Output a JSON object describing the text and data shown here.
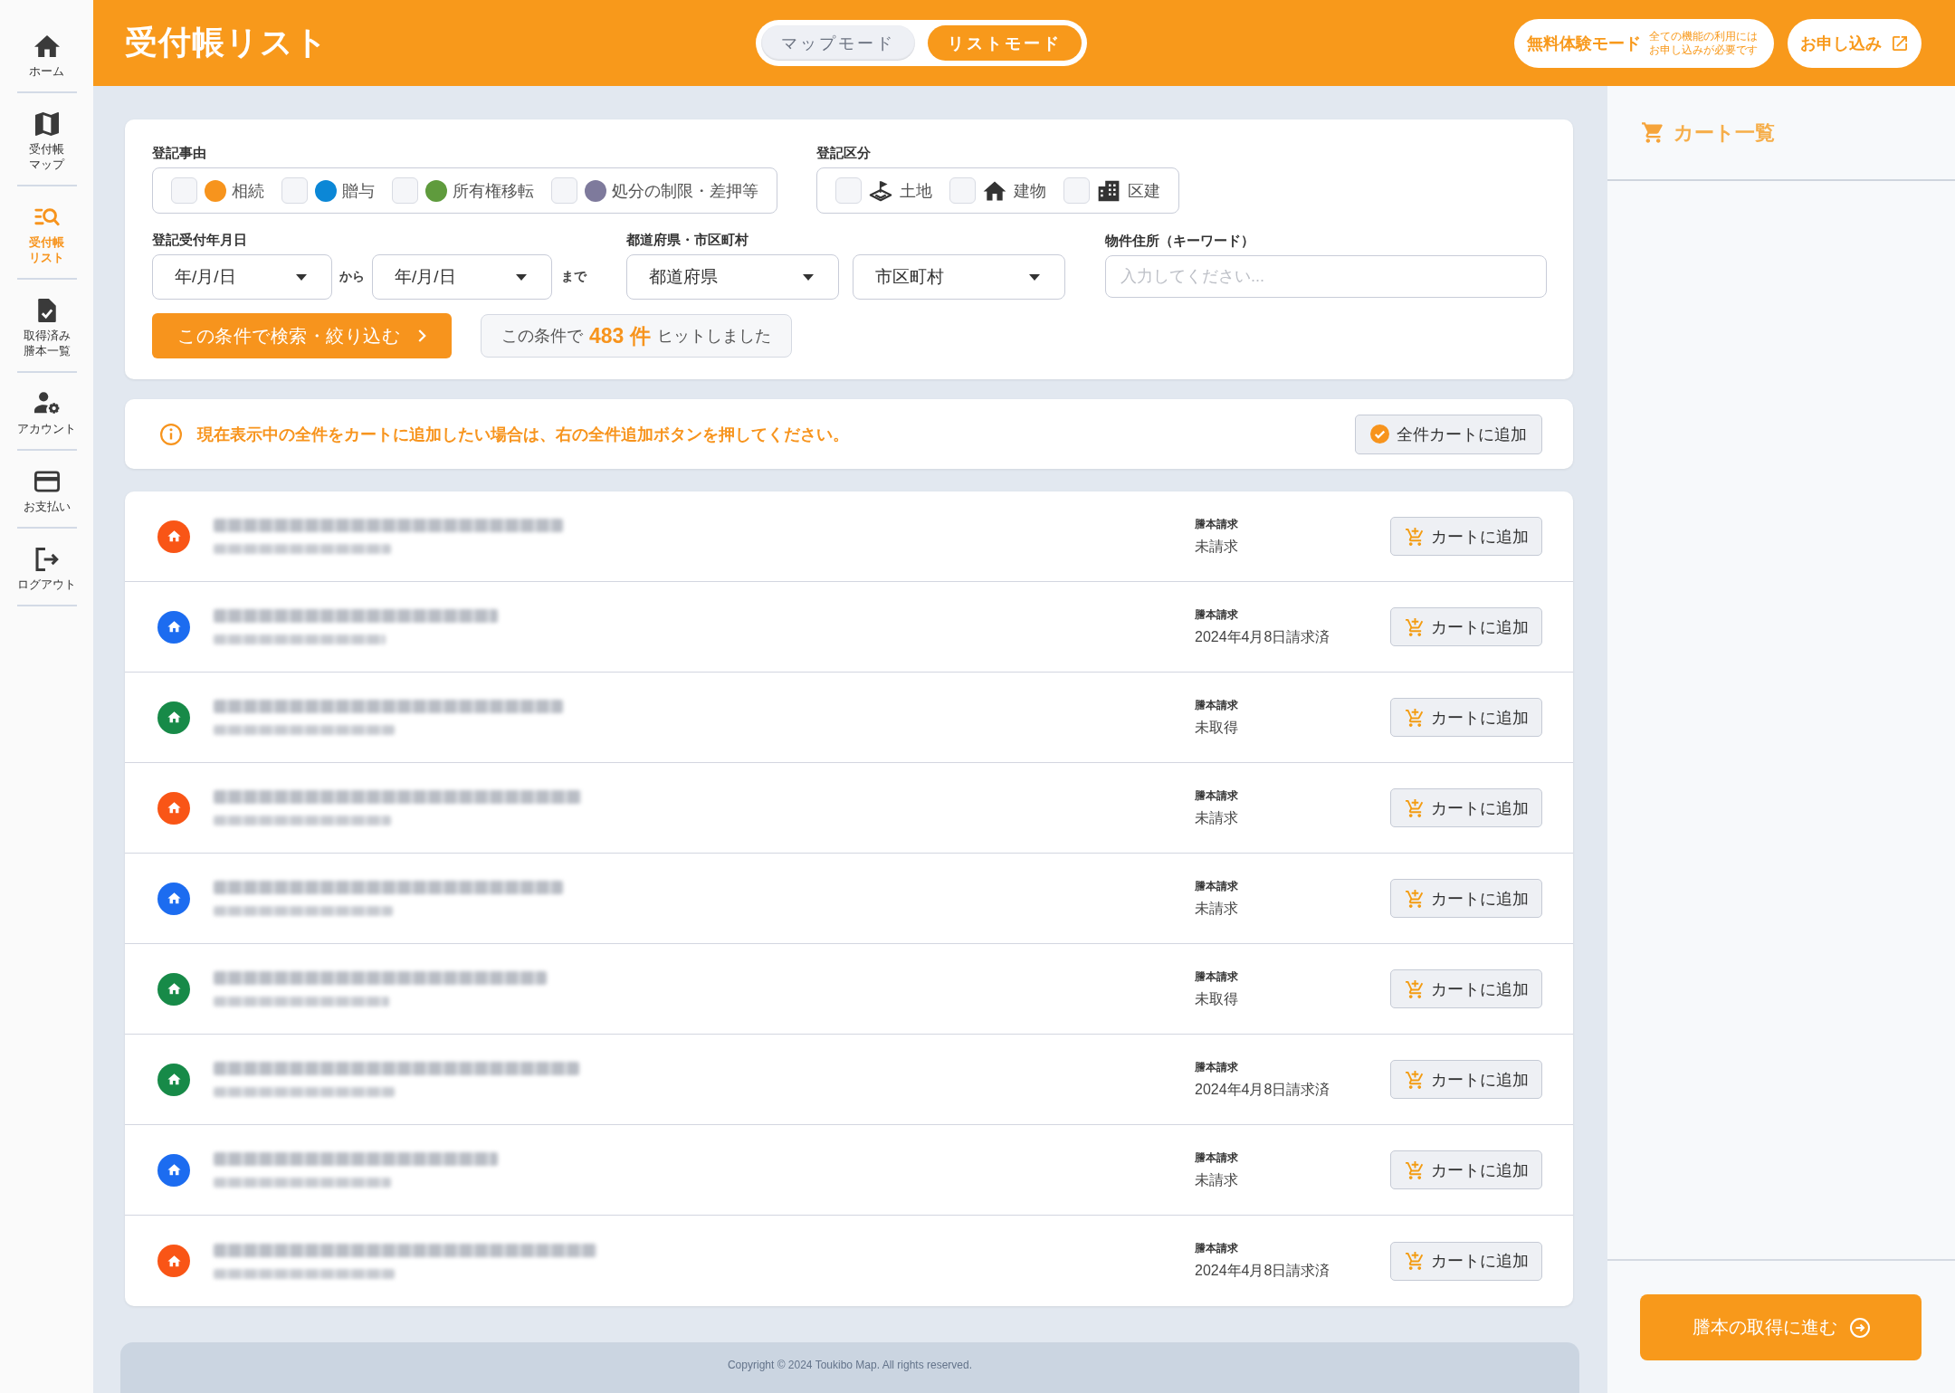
{
  "sidebar": {
    "items": [
      {
        "label": "ホーム",
        "selected": false
      },
      {
        "label": "受付帳マップ",
        "selected": false
      },
      {
        "label": "受付帳リスト",
        "selected": true
      },
      {
        "label": "取得済み謄本一覧",
        "selected": false
      },
      {
        "label": "アカウント",
        "selected": false
      },
      {
        "label": "お支払い",
        "selected": false
      },
      {
        "label": "ログアウト",
        "selected": false
      }
    ]
  },
  "header": {
    "title": "受付帳リスト",
    "mode_toggle": [
      {
        "label": "マップモード",
        "selected": false
      },
      {
        "label": "リストモード",
        "selected": true
      }
    ],
    "trial_badge": {
      "title": "無料体験モード",
      "note": "全ての機能の利用にはお申し込みが必要です"
    },
    "apply_link": {
      "label": "お申し込み"
    }
  },
  "filters": {
    "reason": {
      "label": "登記事由",
      "options": [
        {
          "label": "相続",
          "color": "#f7941d",
          "checked": false
        },
        {
          "label": "贈与",
          "color": "#0b87d6",
          "checked": false
        },
        {
          "label": "所有権移転",
          "color": "#5f9b3d",
          "checked": false
        },
        {
          "label": "処分の制限・差押等",
          "color": "#7e7a9c",
          "checked": false
        }
      ]
    },
    "category": {
      "label": "登記区分",
      "options": [
        {
          "label": "土地",
          "checked": false
        },
        {
          "label": "建物",
          "checked": false
        },
        {
          "label": "区建",
          "checked": false
        }
      ]
    },
    "date": {
      "label": "登記受付年月日",
      "from": {
        "value": "年/月/日"
      },
      "from_suffix": "から",
      "to": {
        "value": "年/月/日"
      },
      "to_suffix": "まで"
    },
    "region": {
      "label": "都道府県・市区町村",
      "prefecture": {
        "value": "都道府県"
      },
      "city": {
        "value": "市区町村"
      }
    },
    "address": {
      "label": "物件住所（キーワード）",
      "placeholder": "入力してください..."
    },
    "search_button": "この条件で検索・絞り込む",
    "hit_count": "この条件で **483 件** ヒットしました"
  },
  "notice": {
    "text": "現在表示中の全件をカートに追加したい場合は、右の全件追加ボタンを押してください。",
    "button": "全件カートに追加"
  },
  "rows": [
    {
      "color": "#f95516",
      "status_label": "謄本請求",
      "status": "未請求",
      "button": "カートに追加"
    },
    {
      "color": "#1c6cf0",
      "status_label": "謄本請求",
      "status": "2024年4月8日請求済",
      "button": "カートに追加"
    },
    {
      "color": "#178a48",
      "status_label": "謄本請求",
      "status": "未取得",
      "button": "カートに追加"
    },
    {
      "color": "#f95516",
      "status_label": "謄本請求",
      "status": "未請求",
      "button": "カートに追加"
    },
    {
      "color": "#1c6cf0",
      "status_label": "謄本請求",
      "status": "未請求",
      "button": "カートに追加"
    },
    {
      "color": "#178a48",
      "status_label": "謄本請求",
      "status": "未取得",
      "button": "カートに追加"
    },
    {
      "color": "#178a48",
      "status_label": "謄本請求",
      "status": "2024年4月8日請求済",
      "button": "カートに追加"
    },
    {
      "color": "#1c6cf0",
      "status_label": "謄本請求",
      "status": "未請求",
      "button": "カートに追加"
    },
    {
      "color": "#f95516",
      "status_label": "謄本請求",
      "status": "2024年4月8日請求済",
      "button": "カートに追加"
    }
  ],
  "cart": {
    "title": "カート一覧",
    "button": "謄本の取得に進む"
  },
  "footer": {
    "copyright": "Copyright © 2024 Toukibo Map. All rights reserved."
  }
}
